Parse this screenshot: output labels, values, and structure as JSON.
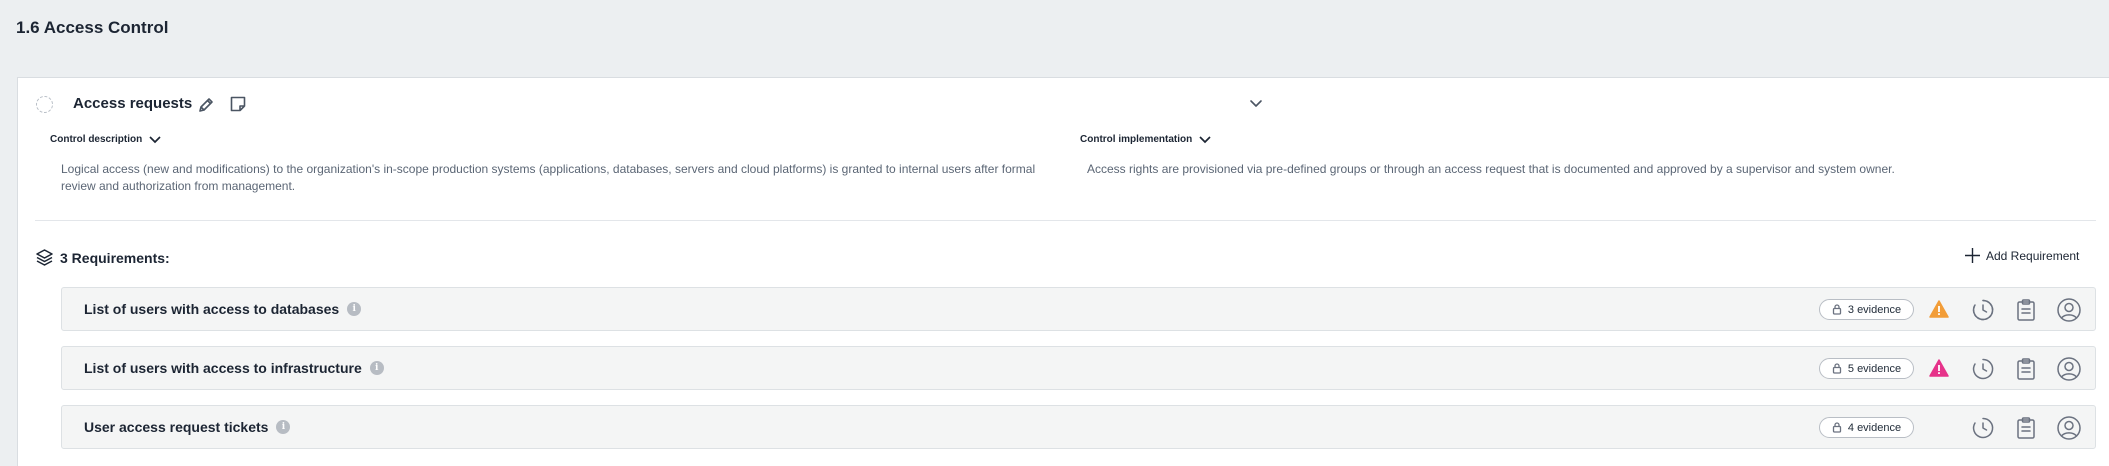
{
  "page": {
    "title": "1.6 Access Control"
  },
  "control": {
    "title": "Access requests",
    "description_label": "Control description",
    "description_text": "Logical access (new and modifications) to the organization's in-scope production systems (applications, databases, servers and cloud platforms) is granted to internal users after formal review and authorization from management.",
    "implementation_label": "Control implementation",
    "implementation_text": "Access rights are provisioned via pre-defined groups or through an access request that is documented and approved by a supervisor and system owner."
  },
  "requirements": {
    "header": "3 Requirements:",
    "add_label": "Add Requirement",
    "items": [
      {
        "name": "List of users with access to databases",
        "evidence": "3 evidence",
        "warning": "orange"
      },
      {
        "name": "List of users with access to infrastructure",
        "evidence": "5 evidence",
        "warning": "pink"
      },
      {
        "name": "User access request tickets",
        "evidence": "4 evidence",
        "warning": "none"
      }
    ]
  },
  "colors": {
    "warning_orange": "#f29d38",
    "warning_pink": "#e6338a",
    "background": "#eceff1"
  },
  "icons": {
    "status": "dashed-circle-icon",
    "edit": "pencil-icon",
    "note": "sticky-note-icon",
    "expand": "chevron-down-icon",
    "layers": "layers-icon",
    "add": "plus-icon",
    "evidence": "lock-icon",
    "warning": "warning-triangle-icon",
    "history": "clock-icon",
    "task": "clipboard-icon",
    "owner": "user-circle-icon"
  }
}
